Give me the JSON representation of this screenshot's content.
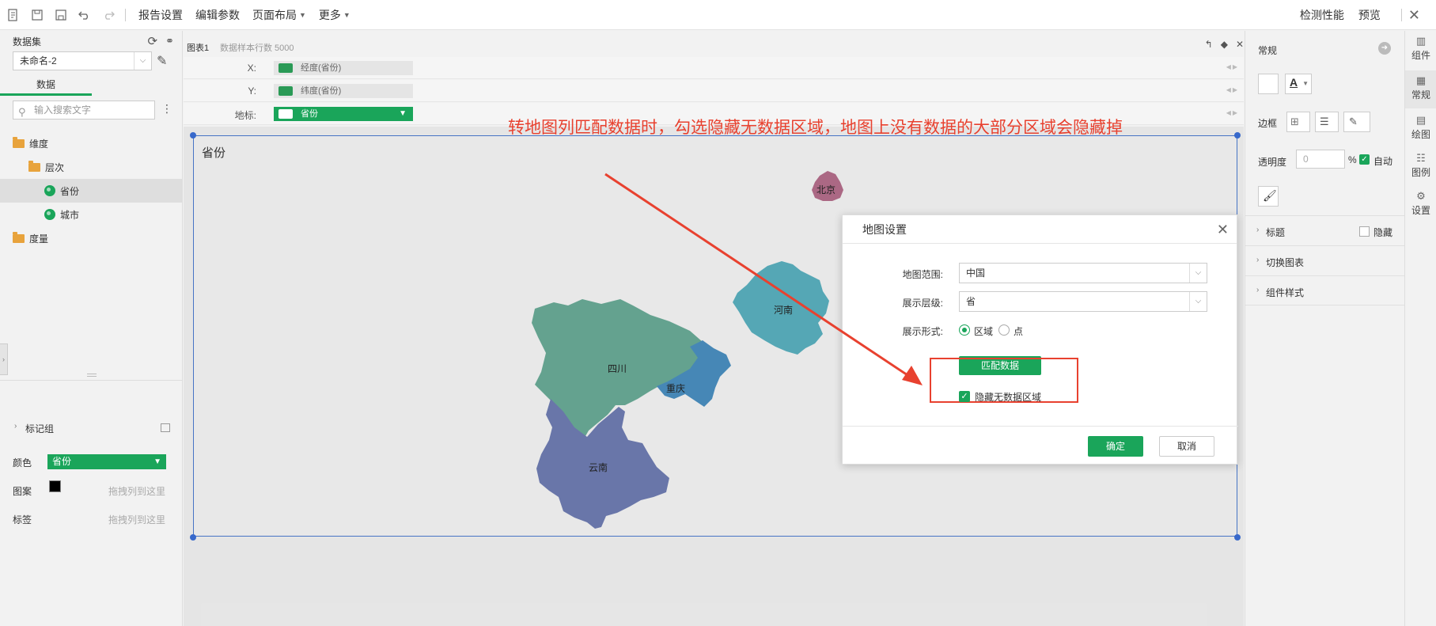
{
  "toolbar": {
    "menus": [
      "报告设置",
      "编辑参数",
      "页面布局",
      "更多"
    ],
    "right_links": [
      "检测性能",
      "预览"
    ]
  },
  "left_panel": {
    "dataset_label": "数据集",
    "dataset_value": "未命名-2",
    "tab_data": "数据",
    "search_placeholder": "输入搜索文字",
    "tree": [
      {
        "label": "维度",
        "kind": "folder"
      },
      {
        "label": "层次",
        "kind": "hier"
      },
      {
        "label": "省份",
        "kind": "geo"
      },
      {
        "label": "城市",
        "kind": "geo"
      },
      {
        "label": "度量",
        "kind": "folder"
      }
    ],
    "marks_header": "标记组",
    "color_label": "颜色",
    "color_field": "省份",
    "pattern_label": "图案",
    "label_label": "标签",
    "drop_hint": "拖拽列到这里"
  },
  "chart": {
    "name": "图表1",
    "sample_rows": "数据样本行数 5000",
    "x_label": "X:",
    "x_field": "经度(省份)",
    "y_label": "Y:",
    "y_field": "纬度(省份)",
    "geo_label": "地标:",
    "geo_field": "省份",
    "canvas_title": "省份",
    "annotation": "转地图列匹配数据时，勾选隐藏无数据区域，地图上没有数据的大部分区域会隐藏掉",
    "regions": [
      "北京",
      "河南",
      "四川",
      "重庆",
      "云南"
    ]
  },
  "dialog": {
    "title": "地图设置",
    "range_label": "地图范围:",
    "range_value": "中国",
    "level_label": "展示层级:",
    "level_value": "省",
    "form_label": "展示形式:",
    "form_area": "区域",
    "form_point": "点",
    "match_button": "匹配数据",
    "hide_checkbox": "隐藏无数据区域",
    "ok": "确定",
    "cancel": "取消"
  },
  "right_panel": {
    "title": "常规",
    "border_label": "边框",
    "opacity_label": "透明度",
    "opacity_value": "0",
    "opacity_unit": "%",
    "auto_label": "自动",
    "sections": [
      "标题",
      "切换图表",
      "组件样式"
    ],
    "hide_label": "隐藏",
    "side_tabs": [
      "组件",
      "常规",
      "绘图",
      "图例",
      "设置"
    ]
  },
  "colors": {
    "accent": "#1aa55a",
    "annotation_red": "#e8412f",
    "selection_blue": "#3b6fd6",
    "sichuan": "#6aab97",
    "chongqing": "#4a8fc0",
    "yunnan": "#6f7db3",
    "henan": "#5ab0bf",
    "beijing": "#b56e8c"
  }
}
